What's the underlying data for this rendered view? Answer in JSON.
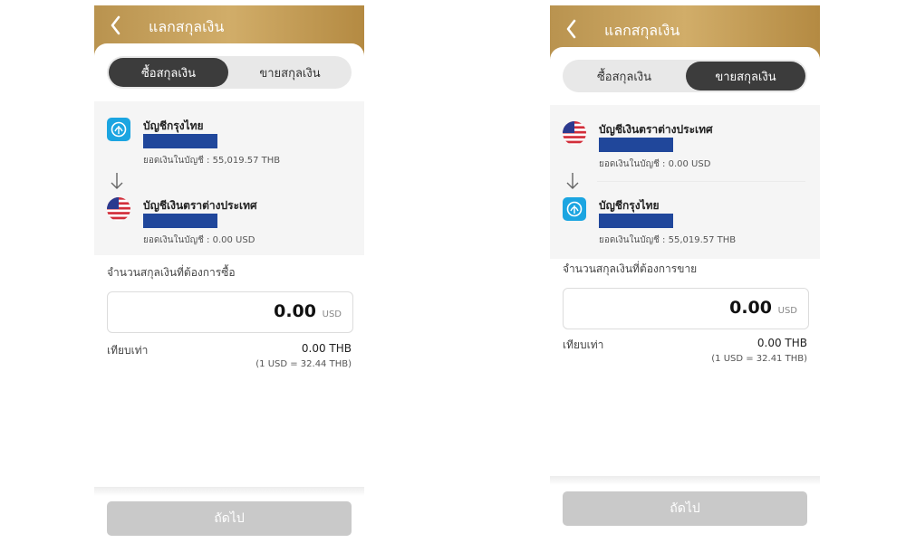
{
  "colors": {
    "header_gold": "#c4a05e",
    "account_mask": "#20479b",
    "active_segment": "#3c3c3c",
    "disabled_button": "#c9c9c9"
  },
  "screens": [
    {
      "title": "แลกสกุลเงิน",
      "tabs": [
        "ซื้อสกุลเงิน",
        "ขายสกุลเงิน"
      ],
      "active_tab": "ซื้อสกุลเงิน",
      "from_account": {
        "icon": "krungthai-bank-icon",
        "name": "บัญชีกรุงไทย",
        "balance": "ยอดเงินในบัญชี : 55,019.57 THB"
      },
      "to_account": {
        "icon": "us-flag-icon",
        "name": "บัญชีเงินตราต่างประเทศ",
        "balance": "ยอดเงินในบัญชี : 0.00 USD"
      },
      "amount_label": "จำนวนสกุลเงินที่ต้องการซื้อ",
      "amount": "0.00",
      "amount_unit": "USD",
      "equiv_label": "เทียบเท่า",
      "equiv_value": "0.00 THB",
      "rate": "(1 USD = 32.44 THB)",
      "next_label": "ถัดไป"
    },
    {
      "title": "แลกสกุลเงิน",
      "tabs": [
        "ซื้อสกุลเงิน",
        "ขายสกุลเงิน"
      ],
      "active_tab": "ขายสกุลเงิน",
      "from_account": {
        "icon": "us-flag-icon",
        "name": "บัญชีเงินตราต่างประเทศ",
        "balance": "ยอดเงินในบัญชี : 0.00 USD"
      },
      "to_account": {
        "icon": "krungthai-bank-icon",
        "name": "บัญชีกรุงไทย",
        "balance": "ยอดเงินในบัญชี : 55,019.57 THB"
      },
      "amount_label": "จำนวนสกุลเงินที่ต้องการขาย",
      "amount": "0.00",
      "amount_unit": "USD",
      "equiv_label": "เทียบเท่า",
      "equiv_value": "0.00 THB",
      "rate": "(1 USD = 32.41 THB)",
      "next_label": "ถัดไป"
    }
  ]
}
